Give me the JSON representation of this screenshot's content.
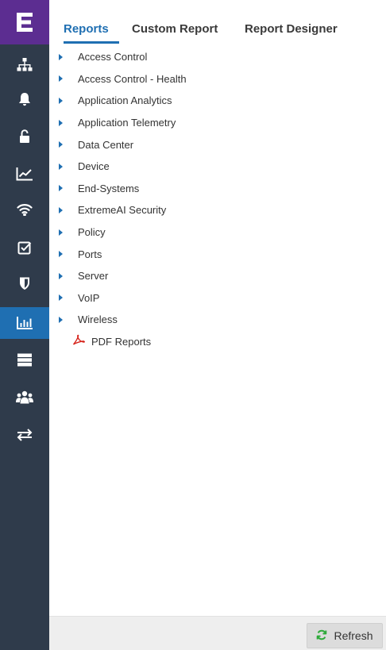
{
  "colors": {
    "rail_bg": "#2f3b4b",
    "logo_bg": "#5c2d91",
    "accent": "#1f6fb2",
    "pdf_icon": "#d6241c",
    "refresh_icon": "#2eaa3a"
  },
  "sidebar": {
    "logo_icon": "extreme-e-logo",
    "items": [
      {
        "icon": "network-hierarchy-icon",
        "active": false
      },
      {
        "icon": "bell-icon",
        "active": false
      },
      {
        "icon": "unlock-icon",
        "active": false
      },
      {
        "icon": "line-chart-icon",
        "active": false
      },
      {
        "icon": "wifi-icon",
        "active": false
      },
      {
        "icon": "checkbox-icon",
        "active": false
      },
      {
        "icon": "shield-icon",
        "active": false
      },
      {
        "icon": "bar-chart-icon",
        "active": true
      },
      {
        "icon": "server-icon",
        "active": false
      },
      {
        "icon": "users-icon",
        "active": false
      },
      {
        "icon": "arrows-exchange-icon",
        "active": false
      }
    ]
  },
  "tabs": [
    {
      "label": "Reports",
      "active": true
    },
    {
      "label": "Custom Report",
      "active": false
    },
    {
      "label": "Report Designer",
      "active": false
    }
  ],
  "tree": {
    "folders": [
      "Access Control",
      "Access Control - Health",
      "Application Analytics",
      "Application Telemetry",
      "Data Center",
      "Device",
      "End-Systems",
      "ExtremeAI Security",
      "Policy",
      "Ports",
      "Server",
      "VoIP",
      "Wireless"
    ],
    "pdf_item": {
      "label": "PDF Reports",
      "icon": "pdf-icon"
    }
  },
  "footer": {
    "refresh_label": "Refresh",
    "refresh_icon": "refresh-icon"
  }
}
